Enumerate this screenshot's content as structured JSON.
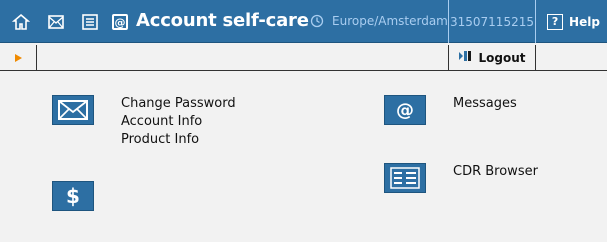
{
  "header": {
    "title": "Account self-care",
    "title_box_glyph": "@",
    "timezone": "Europe/Amsterdam",
    "account_id": "31507115215",
    "help_label": "Help",
    "help_box_glyph": "?"
  },
  "toolbar": {
    "logout_label": "Logout"
  },
  "menu": {
    "change_password": "Change Password",
    "account_info": "Account Info",
    "product_info": "Product Info",
    "messages": "Messages",
    "cdr_browser": "CDR Browser",
    "dollar_glyph": "$",
    "at_glyph": "@"
  },
  "colors": {
    "header_bg": "#2d6fa3",
    "header_light_text": "#a9cdf0",
    "page_bg": "#f2f2f2",
    "play_arrow": "#f08a00"
  },
  "icons": {
    "header": [
      "home-icon",
      "mail-icon",
      "list-icon",
      "at-icon",
      "clock-icon",
      "help-icon"
    ],
    "toolbar": [
      "play-arrow-icon",
      "logout-icon"
    ],
    "content": [
      "envelope-icon",
      "dollar-icon",
      "at-icon",
      "cdr-list-icon"
    ]
  }
}
